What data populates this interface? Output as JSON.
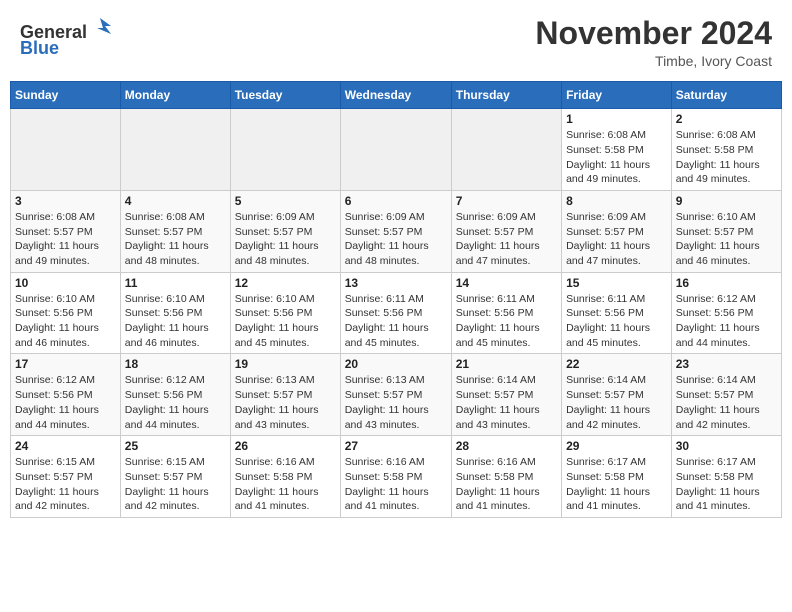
{
  "header": {
    "logo_general": "General",
    "logo_blue": "Blue",
    "month": "November 2024",
    "location": "Timbe, Ivory Coast"
  },
  "days_of_week": [
    "Sunday",
    "Monday",
    "Tuesday",
    "Wednesday",
    "Thursday",
    "Friday",
    "Saturday"
  ],
  "weeks": [
    [
      {
        "day": "",
        "info": ""
      },
      {
        "day": "",
        "info": ""
      },
      {
        "day": "",
        "info": ""
      },
      {
        "day": "",
        "info": ""
      },
      {
        "day": "",
        "info": ""
      },
      {
        "day": "1",
        "info": "Sunrise: 6:08 AM\nSunset: 5:58 PM\nDaylight: 11 hours and 49 minutes."
      },
      {
        "day": "2",
        "info": "Sunrise: 6:08 AM\nSunset: 5:58 PM\nDaylight: 11 hours and 49 minutes."
      }
    ],
    [
      {
        "day": "3",
        "info": "Sunrise: 6:08 AM\nSunset: 5:57 PM\nDaylight: 11 hours and 49 minutes."
      },
      {
        "day": "4",
        "info": "Sunrise: 6:08 AM\nSunset: 5:57 PM\nDaylight: 11 hours and 48 minutes."
      },
      {
        "day": "5",
        "info": "Sunrise: 6:09 AM\nSunset: 5:57 PM\nDaylight: 11 hours and 48 minutes."
      },
      {
        "day": "6",
        "info": "Sunrise: 6:09 AM\nSunset: 5:57 PM\nDaylight: 11 hours and 48 minutes."
      },
      {
        "day": "7",
        "info": "Sunrise: 6:09 AM\nSunset: 5:57 PM\nDaylight: 11 hours and 47 minutes."
      },
      {
        "day": "8",
        "info": "Sunrise: 6:09 AM\nSunset: 5:57 PM\nDaylight: 11 hours and 47 minutes."
      },
      {
        "day": "9",
        "info": "Sunrise: 6:10 AM\nSunset: 5:57 PM\nDaylight: 11 hours and 46 minutes."
      }
    ],
    [
      {
        "day": "10",
        "info": "Sunrise: 6:10 AM\nSunset: 5:56 PM\nDaylight: 11 hours and 46 minutes."
      },
      {
        "day": "11",
        "info": "Sunrise: 6:10 AM\nSunset: 5:56 PM\nDaylight: 11 hours and 46 minutes."
      },
      {
        "day": "12",
        "info": "Sunrise: 6:10 AM\nSunset: 5:56 PM\nDaylight: 11 hours and 45 minutes."
      },
      {
        "day": "13",
        "info": "Sunrise: 6:11 AM\nSunset: 5:56 PM\nDaylight: 11 hours and 45 minutes."
      },
      {
        "day": "14",
        "info": "Sunrise: 6:11 AM\nSunset: 5:56 PM\nDaylight: 11 hours and 45 minutes."
      },
      {
        "day": "15",
        "info": "Sunrise: 6:11 AM\nSunset: 5:56 PM\nDaylight: 11 hours and 45 minutes."
      },
      {
        "day": "16",
        "info": "Sunrise: 6:12 AM\nSunset: 5:56 PM\nDaylight: 11 hours and 44 minutes."
      }
    ],
    [
      {
        "day": "17",
        "info": "Sunrise: 6:12 AM\nSunset: 5:56 PM\nDaylight: 11 hours and 44 minutes."
      },
      {
        "day": "18",
        "info": "Sunrise: 6:12 AM\nSunset: 5:56 PM\nDaylight: 11 hours and 44 minutes."
      },
      {
        "day": "19",
        "info": "Sunrise: 6:13 AM\nSunset: 5:57 PM\nDaylight: 11 hours and 43 minutes."
      },
      {
        "day": "20",
        "info": "Sunrise: 6:13 AM\nSunset: 5:57 PM\nDaylight: 11 hours and 43 minutes."
      },
      {
        "day": "21",
        "info": "Sunrise: 6:14 AM\nSunset: 5:57 PM\nDaylight: 11 hours and 43 minutes."
      },
      {
        "day": "22",
        "info": "Sunrise: 6:14 AM\nSunset: 5:57 PM\nDaylight: 11 hours and 42 minutes."
      },
      {
        "day": "23",
        "info": "Sunrise: 6:14 AM\nSunset: 5:57 PM\nDaylight: 11 hours and 42 minutes."
      }
    ],
    [
      {
        "day": "24",
        "info": "Sunrise: 6:15 AM\nSunset: 5:57 PM\nDaylight: 11 hours and 42 minutes."
      },
      {
        "day": "25",
        "info": "Sunrise: 6:15 AM\nSunset: 5:57 PM\nDaylight: 11 hours and 42 minutes."
      },
      {
        "day": "26",
        "info": "Sunrise: 6:16 AM\nSunset: 5:58 PM\nDaylight: 11 hours and 41 minutes."
      },
      {
        "day": "27",
        "info": "Sunrise: 6:16 AM\nSunset: 5:58 PM\nDaylight: 11 hours and 41 minutes."
      },
      {
        "day": "28",
        "info": "Sunrise: 6:16 AM\nSunset: 5:58 PM\nDaylight: 11 hours and 41 minutes."
      },
      {
        "day": "29",
        "info": "Sunrise: 6:17 AM\nSunset: 5:58 PM\nDaylight: 11 hours and 41 minutes."
      },
      {
        "day": "30",
        "info": "Sunrise: 6:17 AM\nSunset: 5:58 PM\nDaylight: 11 hours and 41 minutes."
      }
    ]
  ]
}
